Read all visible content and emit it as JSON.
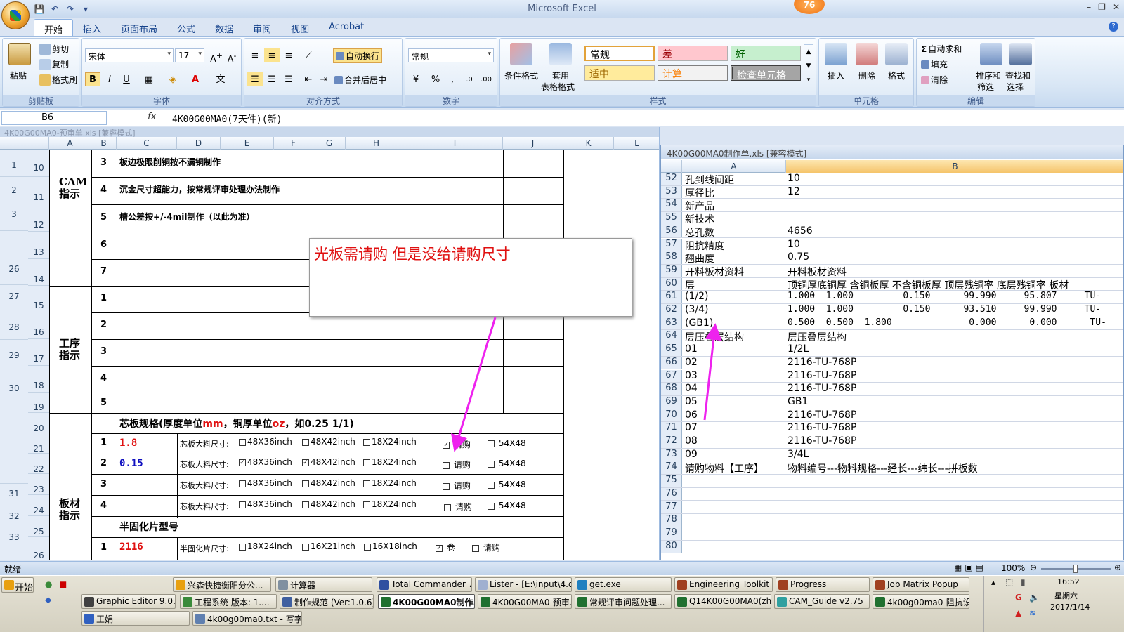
{
  "window": {
    "app_title": "Microsoft Excel",
    "badge": "76"
  },
  "tabs": [
    "开始",
    "插入",
    "页面布局",
    "公式",
    "数据",
    "审阅",
    "视图",
    "Acrobat"
  ],
  "ribbon": {
    "clipboard": {
      "paste": "粘贴",
      "cut": "剪切",
      "copy": "复制",
      "format_painter": "格式刷",
      "label": "剪贴板"
    },
    "font": {
      "name": "宋体",
      "size": "17",
      "label": "字体"
    },
    "align": {
      "wrap": "自动换行",
      "merge": "合并后居中",
      "label": "对齐方式"
    },
    "number": {
      "format": "常规",
      "label": "数字"
    },
    "styles": {
      "conditional": "条件格式",
      "table_format_1": "套用",
      "table_format_2": "表格格式",
      "s_normal": "常规",
      "s_bad": "差",
      "s_good": "好",
      "s_neutral": "适中",
      "s_calc": "计算",
      "s_check": "检查单元格",
      "label": "样式"
    },
    "cells": {
      "insert": "插入",
      "delete": "删除",
      "format": "格式",
      "label": "单元格"
    },
    "editing": {
      "autosum": "自动求和",
      "fill": "填充",
      "clear": "清除",
      "sort_1": "排序和",
      "sort_2": "筛选",
      "find_1": "查找和",
      "find_2": "选择",
      "label": "编辑"
    }
  },
  "formula_bar": {
    "cell_ref": "B6",
    "fx": "fx",
    "content": "4K00G00MA0(7天件)(新)"
  },
  "left_sheet": {
    "title": "4K00G00MA0-预审单.xls [兼容模式]",
    "columns": [
      "A",
      "B",
      "C",
      "D",
      "E",
      "F",
      "G",
      "H",
      "I",
      "J",
      "K",
      "L"
    ],
    "outer_rows": [
      "1",
      "2",
      "3",
      "26",
      "27",
      "28",
      "29",
      "30",
      "31",
      "32",
      "33"
    ],
    "inner_rows": [
      "10",
      "11",
      "12",
      "13",
      "14",
      "15",
      "16",
      "17",
      "18",
      "19",
      "20",
      "21",
      "22",
      "23",
      "24",
      "25",
      "26"
    ],
    "cam_label": "CAM\n指示",
    "cam_items": [
      "3",
      "4",
      "5",
      "6",
      "7"
    ],
    "cam_texts": [
      "板边极限削铜按不漏铜制作",
      "沉金尺寸超能力，按常规评审处理办法制作",
      "槽公差按+/-4mil制作（以此为准）"
    ],
    "proc_label": "工序\n指示",
    "proc_items": [
      "1",
      "2",
      "3",
      "4",
      "5"
    ],
    "board_label": "板材\n指示",
    "core_header": "芯板规格(厚度单位",
    "core_header_mm": "mm",
    "core_header_mid": "，铜厚单位",
    "core_header_oz": "oz",
    "core_header_end": "，如0.25  1/1)",
    "core_rows": [
      {
        "idx": "1",
        "thick": "1.8",
        "label": "芯板大料尺寸:",
        "o1": "48X36inch",
        "o2": "48X42inch",
        "o3": "18X24inch",
        "c1": "",
        "c2": "",
        "c3": "",
        "buy": "请购",
        "buy_c": "✓",
        "s": "54X48"
      },
      {
        "idx": "2",
        "thick": "0.15",
        "label": "芯板大料尺寸:",
        "o1": "48X36inch",
        "o2": "48X42inch",
        "o3": "18X24inch",
        "c1": "✓",
        "c2": "✓",
        "c3": "",
        "buy": "请购",
        "buy_c": "",
        "s": "54X48"
      },
      {
        "idx": "3",
        "thick": "",
        "label": "芯板大料尺寸:",
        "o1": "48X36inch",
        "o2": "48X42inch",
        "o3": "18X24inch",
        "c1": "",
        "c2": "",
        "c3": "",
        "buy": "请购",
        "buy_c": "",
        "s": "54X48"
      },
      {
        "idx": "4",
        "thick": "",
        "label": "芯板大料尺寸:",
        "o1": "48X36inch",
        "o2": "48X42inch",
        "o3": "18X24inch",
        "c1": "",
        "c2": "",
        "c3": "",
        "buy": "请购",
        "buy_c": "",
        "s": "54X48"
      }
    ],
    "pp_header": "半固化片型号",
    "pp_row": {
      "idx": "1",
      "type": "2116",
      "label": "半固化片尺寸:",
      "o1": "18X24inch",
      "o2": "16X21inch",
      "o3": "16X18inch",
      "roll": "卷",
      "buy": "请购"
    }
  },
  "callout": "光板需请购  但是没给请购尺寸",
  "right_sheet": {
    "title": "4K00G00MA0制作单.xls  [兼容模式]",
    "col_a": "A",
    "col_b": "B",
    "rows": [
      {
        "n": "52",
        "a": "孔到线间距",
        "b": "10"
      },
      {
        "n": "53",
        "a": "厚径比",
        "b": "12"
      },
      {
        "n": "54",
        "a": "新产品",
        "b": ""
      },
      {
        "n": "55",
        "a": "新技术",
        "b": ""
      },
      {
        "n": "56",
        "a": "总孔数",
        "b": "4656"
      },
      {
        "n": "57",
        "a": "阻抗精度",
        "b": "10"
      },
      {
        "n": "58",
        "a": "翘曲度",
        "b": "0.75"
      },
      {
        "n": "59",
        "a": "开料板材资料",
        "b": "开料板材资料"
      },
      {
        "n": "60",
        "a": "层",
        "b": "顶铜厚底铜厚 含铜板厚 不含铜板厚 顶层残铜率 底层残铜率 板材"
      },
      {
        "n": "61",
        "a": "(1/2)",
        "b": "1.000  1.000         0.150      99.990     95.807     TU-"
      },
      {
        "n": "62",
        "a": "(3/4)",
        "b": "1.000  1.000         0.150      93.510     99.990     TU-"
      },
      {
        "n": "63",
        "a": "(GB1)",
        "b": "0.500  0.500  1.800              0.000      0.000      TU-"
      },
      {
        "n": "64",
        "a": "层压叠层结构",
        "b": "层压叠层结构"
      },
      {
        "n": "65",
        "a": "01",
        "b": "1/2L"
      },
      {
        "n": "66",
        "a": "02",
        "b": "2116-TU-768P"
      },
      {
        "n": "67",
        "a": "03",
        "b": "2116-TU-768P"
      },
      {
        "n": "68",
        "a": "04",
        "b": "2116-TU-768P"
      },
      {
        "n": "69",
        "a": "05",
        "b": "GB1"
      },
      {
        "n": "70",
        "a": "06",
        "b": "2116-TU-768P"
      },
      {
        "n": "71",
        "a": "07",
        "b": "2116-TU-768P"
      },
      {
        "n": "72",
        "a": "08",
        "b": "2116-TU-768P"
      },
      {
        "n": "73",
        "a": "09",
        "b": "3/4L"
      },
      {
        "n": "74",
        "a": "请购物料【工序】",
        "b": "物料编号---物料规格---经长---纬长---拼板数"
      },
      {
        "n": "75",
        "a": "",
        "b": ""
      },
      {
        "n": "76",
        "a": "",
        "b": ""
      },
      {
        "n": "77",
        "a": "",
        "b": ""
      },
      {
        "n": "78",
        "a": "",
        "b": ""
      },
      {
        "n": "79",
        "a": "",
        "b": ""
      },
      {
        "n": "80",
        "a": "",
        "b": ""
      }
    ]
  },
  "status": {
    "ready": "就绪",
    "zoom": "100%"
  },
  "taskbar": {
    "start": "开始",
    "row1": [
      "兴森快捷衡阳分公...",
      "计算器",
      "Total Commander 7.0...",
      "Lister - [E:\\input\\4.drl]",
      "get.exe",
      "Engineering Toolkit 9....",
      "Progress",
      "Job Matrix Popup"
    ],
    "row2": [
      "Graphic Editor 9.07b...",
      "工程系统  版本: 1....",
      "制作规范 (Ver:1.0.6)",
      "4K00G00MA0制作...",
      "4K00G00MA0-预审...",
      "常规评审问题处理...",
      "Q14K00G00MA0(zha...",
      "CAM_Guide v2.75",
      "4k00g00ma0-阻抗设..."
    ],
    "row3": [
      "王娟",
      "4k00g00ma0.txt - 写字板"
    ],
    "time": "16:52",
    "weekday": "星期六",
    "date": "2017/1/14"
  },
  "colors": {
    "accent": "#15428b",
    "callout_text": "#e01010",
    "arrow": "#ee22ee",
    "bad_bg": "#ffc7ce",
    "good_bg": "#c6efce",
    "neutral_bg": "#ffeb9c"
  }
}
